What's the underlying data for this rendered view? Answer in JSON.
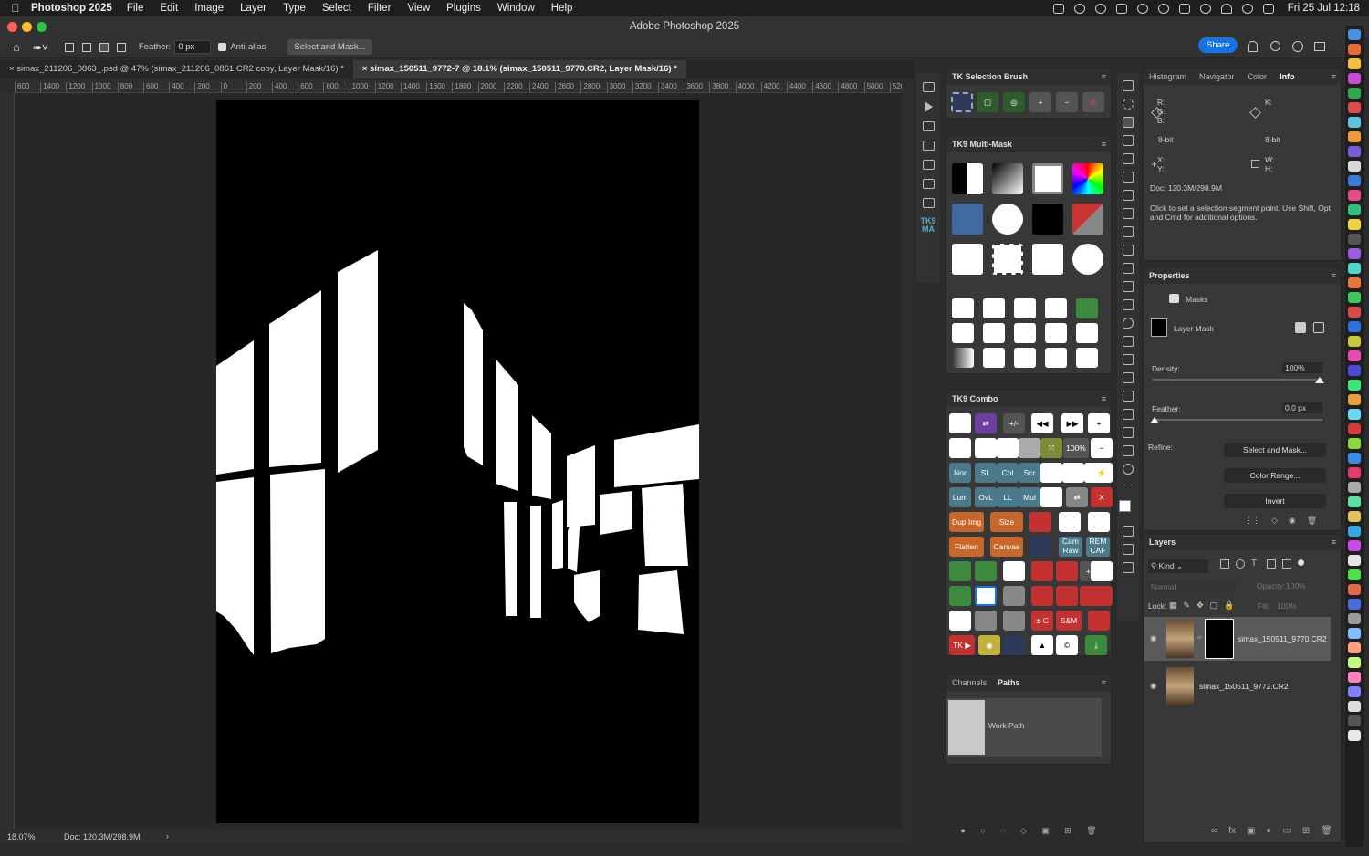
{
  "menubar": {
    "app_name": "Photoshop 2025",
    "items": [
      "File",
      "Edit",
      "Image",
      "Layer",
      "Type",
      "Select",
      "Filter",
      "View",
      "Plugins",
      "Window",
      "Help"
    ],
    "clock": "Fri 25 Jul  12:18"
  },
  "window": {
    "title": "Adobe Photoshop 2025"
  },
  "options": {
    "feather_label": "Feather:",
    "feather_value": "0 px",
    "antialias_label": "Anti-alias",
    "select_mask_label": "Select and Mask...",
    "share_label": "Share"
  },
  "tabs": [
    {
      "label": "simax_211206_0863_.psd @ 47% (simax_211206_0861.CR2 copy, Layer Mask/16) *",
      "active": false
    },
    {
      "label": "simax_150511_9772-7 @ 18.1% (simax_150511_9770.CR2, Layer Mask/16) *",
      "active": true
    }
  ],
  "ruler_labels": [
    "600",
    "1400",
    "1200",
    "1000",
    "800",
    "600",
    "400",
    "200",
    "0",
    "200",
    "400",
    "600",
    "800",
    "1000",
    "1200",
    "1400",
    "1600",
    "1800",
    "2000",
    "2200",
    "2400",
    "2600",
    "2800",
    "3000",
    "3200",
    "3400",
    "3600",
    "3800",
    "4000",
    "4200",
    "4400",
    "4600",
    "4800",
    "5000",
    "520"
  ],
  "status": {
    "zoom": "18.07%",
    "doc": "Doc: 120.3M/298.9M"
  },
  "tk_selection": {
    "title": "TK Selection Brush"
  },
  "tk_multimask": {
    "title": "TK9 Multi-Mask"
  },
  "tk_combo": {
    "title": "TK9 Combo",
    "labels": {
      "pct100": "100%",
      "nor": "Nor",
      "sl": "SL",
      "col": "Col",
      "scr": "Scr",
      "lum": "Lum",
      "ovl": "OvL",
      "ll": "LL",
      "mul": "Mul",
      "dup": "Dup Img",
      "size": "Size",
      "flatten": "Flatten",
      "canvas": "Canvas",
      "cam": "Cam Raw",
      "rem": "REM CAF",
      "pm": "±-C",
      "sm": "S&M",
      "tk": "TK ▶",
      "x": "X",
      "c": "©",
      "plusminus": "+/-",
      "plusminus2": "+/-"
    }
  },
  "paths_panel": {
    "tabs": [
      "Channels",
      "Paths"
    ],
    "work_path": "Work Path"
  },
  "info_panel": {
    "tabs": [
      "Histogram",
      "Navigator",
      "Color",
      "Info"
    ],
    "rgb": "R:\nG:\nB:",
    "k": "K:",
    "bit1": "8-bit",
    "bit2": "8-bit",
    "xy": "X:\nY:",
    "wh": "W:\nH:",
    "doc": "Doc: 120.3M/298.9M",
    "hint": "Click to set a selection segment point.  Use Shift, Opt and Cmd for additional options."
  },
  "properties": {
    "title": "Properties",
    "masks": "Masks",
    "layer_mask": "Layer Mask",
    "density_label": "Density:",
    "density": "100%",
    "density_fraction": 1.0,
    "feather_label": "Feather:",
    "feather": "0.0 px",
    "refine_label": "Refine:",
    "btn_select_mask": "Select and Mask...",
    "btn_color_range": "Color Range...",
    "btn_invert": "Invert"
  },
  "layers": {
    "title": "Layers",
    "kind": "Kind",
    "blend": "Normal",
    "opacity_label": "Opacity:",
    "opacity": "100%",
    "lock_label": "Lock:",
    "fill_label": "Fill:",
    "fill": "100%",
    "rows": [
      {
        "name": "simax_150511_9770.CR2",
        "selected": true
      },
      {
        "name": "simax_150511_9772.CR2",
        "selected": false
      }
    ]
  },
  "colors": {
    "accent": "#1473e6",
    "panel": "#383838",
    "orange_btn": "#c8672a",
    "green_btn": "#3b8a3e",
    "teal_btn": "#4a7a8c",
    "red_btn": "#c43131"
  }
}
